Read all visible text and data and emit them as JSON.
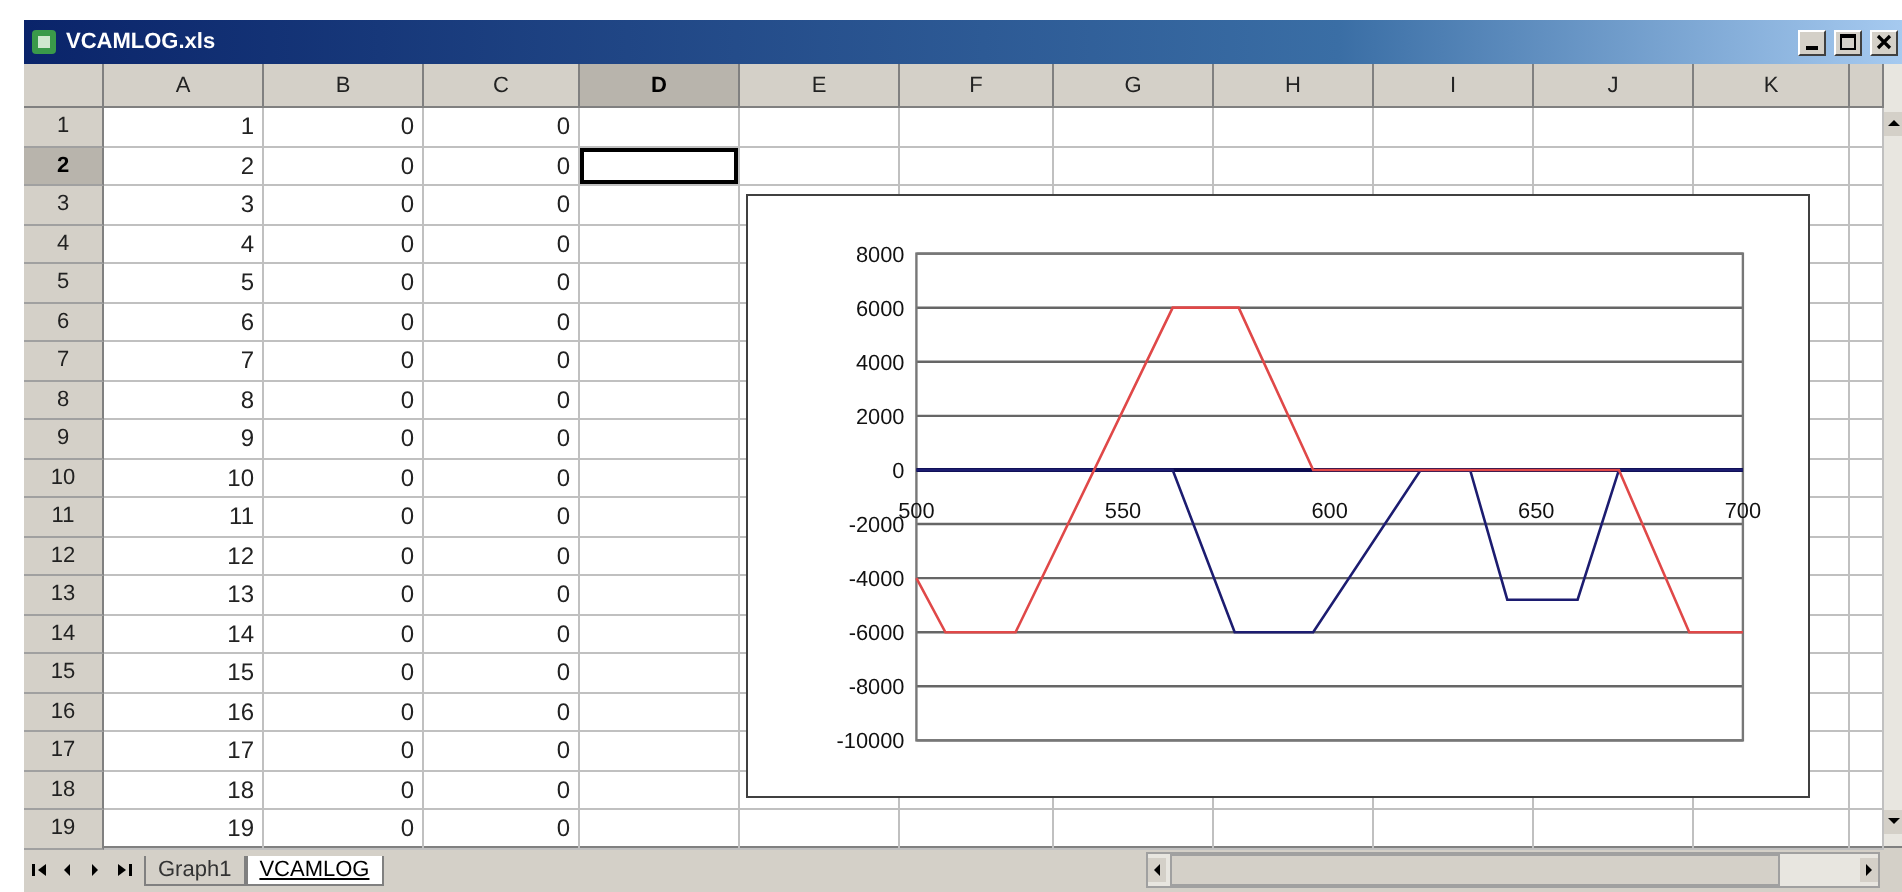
{
  "window": {
    "title": "VCAMLOG.xls"
  },
  "columns": [
    {
      "label": "A",
      "selected": false
    },
    {
      "label": "B",
      "selected": false
    },
    {
      "label": "C",
      "selected": false
    },
    {
      "label": "D",
      "selected": true
    },
    {
      "label": "E",
      "selected": false
    },
    {
      "label": "F",
      "selected": false
    },
    {
      "label": "G",
      "selected": false
    },
    {
      "label": "H",
      "selected": false
    },
    {
      "label": "I",
      "selected": false
    },
    {
      "label": "J",
      "selected": false
    },
    {
      "label": "K",
      "selected": false
    }
  ],
  "rows": [
    {
      "label": "1",
      "selected": false,
      "cells": [
        "1",
        "0",
        "0"
      ]
    },
    {
      "label": "2",
      "selected": true,
      "cells": [
        "2",
        "0",
        "0"
      ]
    },
    {
      "label": "3",
      "selected": false,
      "cells": [
        "3",
        "0",
        "0"
      ]
    },
    {
      "label": "4",
      "selected": false,
      "cells": [
        "4",
        "0",
        "0"
      ]
    },
    {
      "label": "5",
      "selected": false,
      "cells": [
        "5",
        "0",
        "0"
      ]
    },
    {
      "label": "6",
      "selected": false,
      "cells": [
        "6",
        "0",
        "0"
      ]
    },
    {
      "label": "7",
      "selected": false,
      "cells": [
        "7",
        "0",
        "0"
      ]
    },
    {
      "label": "8",
      "selected": false,
      "cells": [
        "8",
        "0",
        "0"
      ]
    },
    {
      "label": "9",
      "selected": false,
      "cells": [
        "9",
        "0",
        "0"
      ]
    },
    {
      "label": "10",
      "selected": false,
      "cells": [
        "10",
        "0",
        "0"
      ]
    },
    {
      "label": "11",
      "selected": false,
      "cells": [
        "11",
        "0",
        "0"
      ]
    },
    {
      "label": "12",
      "selected": false,
      "cells": [
        "12",
        "0",
        "0"
      ]
    },
    {
      "label": "13",
      "selected": false,
      "cells": [
        "13",
        "0",
        "0"
      ]
    },
    {
      "label": "14",
      "selected": false,
      "cells": [
        "14",
        "0",
        "0"
      ]
    },
    {
      "label": "15",
      "selected": false,
      "cells": [
        "15",
        "0",
        "0"
      ]
    },
    {
      "label": "16",
      "selected": false,
      "cells": [
        "16",
        "0",
        "0"
      ]
    },
    {
      "label": "17",
      "selected": false,
      "cells": [
        "17",
        "0",
        "0"
      ]
    },
    {
      "label": "18",
      "selected": false,
      "cells": [
        "18",
        "0",
        "0"
      ]
    },
    {
      "label": "19",
      "selected": false,
      "cells": [
        "19",
        "0",
        "0"
      ]
    }
  ],
  "chart": {
    "chart_data": {
      "type": "line",
      "x": [
        500,
        507,
        524,
        562,
        577,
        578,
        596,
        622,
        634,
        643,
        660,
        670,
        687,
        700
      ],
      "series": [
        {
          "color": "#1c1c70",
          "values": [
            0,
            0,
            0,
            0,
            -6000,
            -6000,
            -6000,
            0,
            0,
            -4800,
            -4800,
            0,
            0,
            0
          ]
        },
        {
          "color": "#e04848",
          "values": [
            -4000,
            -6000,
            -6000,
            6000,
            6000,
            6000,
            0,
            0,
            0,
            0,
            0,
            0,
            -6000,
            -6000
          ]
        }
      ],
      "xlim": [
        500,
        700
      ],
      "ylim": [
        -10000,
        8000
      ],
      "xticks": [
        500,
        550,
        600,
        650,
        700
      ],
      "yticks": [
        8000,
        6000,
        4000,
        2000,
        0,
        -2000,
        -4000,
        -6000,
        -8000,
        -10000
      ],
      "grid": true
    }
  },
  "sheet_tabs": [
    {
      "label": "Graph1",
      "selected": false
    },
    {
      "label": "VCAMLOG",
      "selected": true
    }
  ]
}
